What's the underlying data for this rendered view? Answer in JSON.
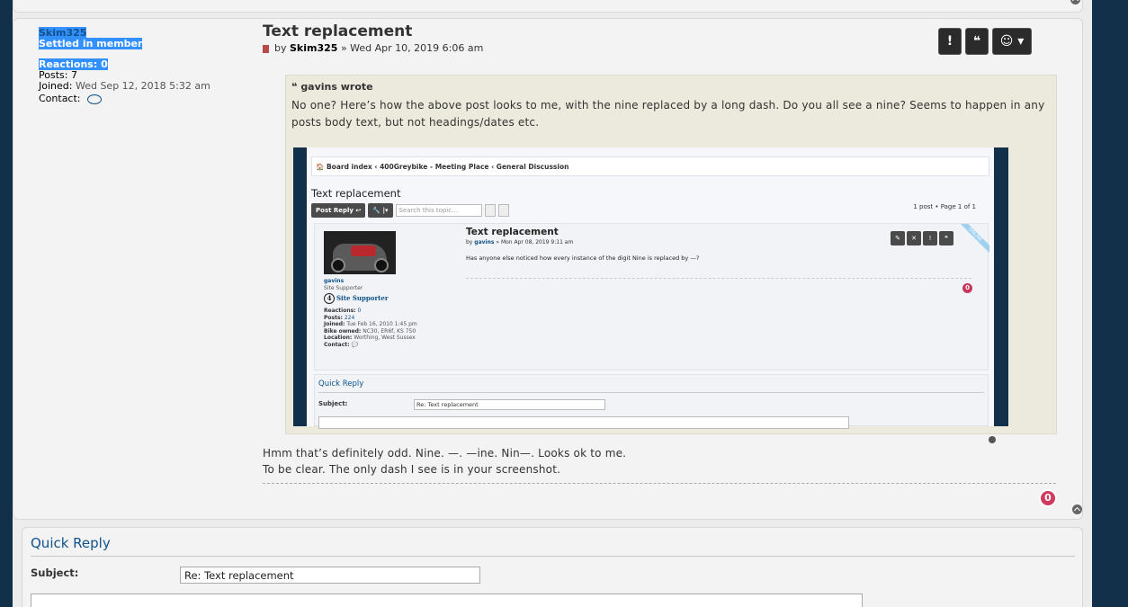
{
  "profile": {
    "username": "Skim325",
    "rank": "Settled in member",
    "reactions_label": "Reactions:",
    "reactions_value": "0",
    "posts_label": "Posts:",
    "posts_value": "7",
    "joined_label": "Joined:",
    "joined_value": "Wed Sep 12, 2018 5:32 am",
    "contact_label": "Contact:"
  },
  "post": {
    "title": "Text replacement",
    "by": "by",
    "author": "Skim325",
    "sep": "»",
    "date": "Wed Apr 10, 2019 6:06 am",
    "actions": {
      "report": "!",
      "quote": "❝",
      "react": "☺ ▾"
    },
    "quote": {
      "cite": "gavins wrote",
      "text": "No one? Here’s how the above post looks to me, with the nine replaced by a long dash. Do you all see a nine? Seems to happen in any posts body text, but not headings/dates etc."
    },
    "reply_lines": [
      "Hmm that’s definitely odd. Nine. —. —ine. Nin—. Looks ok to me.",
      "To be clear. The only dash I see is in your screenshot."
    ],
    "reaction_count": "0"
  },
  "screenshot": {
    "breadcrumb": "🏠 Board index ‹ 400Greybike - Meeting Place ‹ General Discussion",
    "topic_title": "Text replacement",
    "post_reply_btn": "Post Reply ↩",
    "tools_btn": "🔧 |▾",
    "search_placeholder": "Search this topic…",
    "pager": "1 post • Page 1 of 1",
    "post_title": "Text replacement",
    "post_by": "by",
    "post_author": "gavins",
    "post_date": "» Mon Apr 08, 2019 9:11 am",
    "post_body": "Has anyone else noticed how every instance of the digit Nine is replaced by —?",
    "online": "ONLINE",
    "user": "gavins",
    "user_rank": "Site Supporter",
    "badge_num": "4",
    "badge_text": "Site Supporter",
    "reactions": "Reactions:",
    "reactions_val": "0",
    "posts": "Posts:",
    "posts_val": "224",
    "joined": "Joined:",
    "joined_val": "Tue Feb 16, 2010 1:45 pm",
    "bike": "Bike owned:",
    "bike_val": "NC30, ER6f, KS 750",
    "location": "Location:",
    "location_val": "Worthing, West Sussex",
    "contact": "Contact:",
    "react_count": "0",
    "quick_reply": "Quick Reply",
    "subject_label": "Subject:",
    "subject_value": "Re: Text replacement"
  },
  "quick_reply": {
    "title": "Quick Reply",
    "subject_label": "Subject:",
    "subject_value": "Re: Text replacement"
  }
}
